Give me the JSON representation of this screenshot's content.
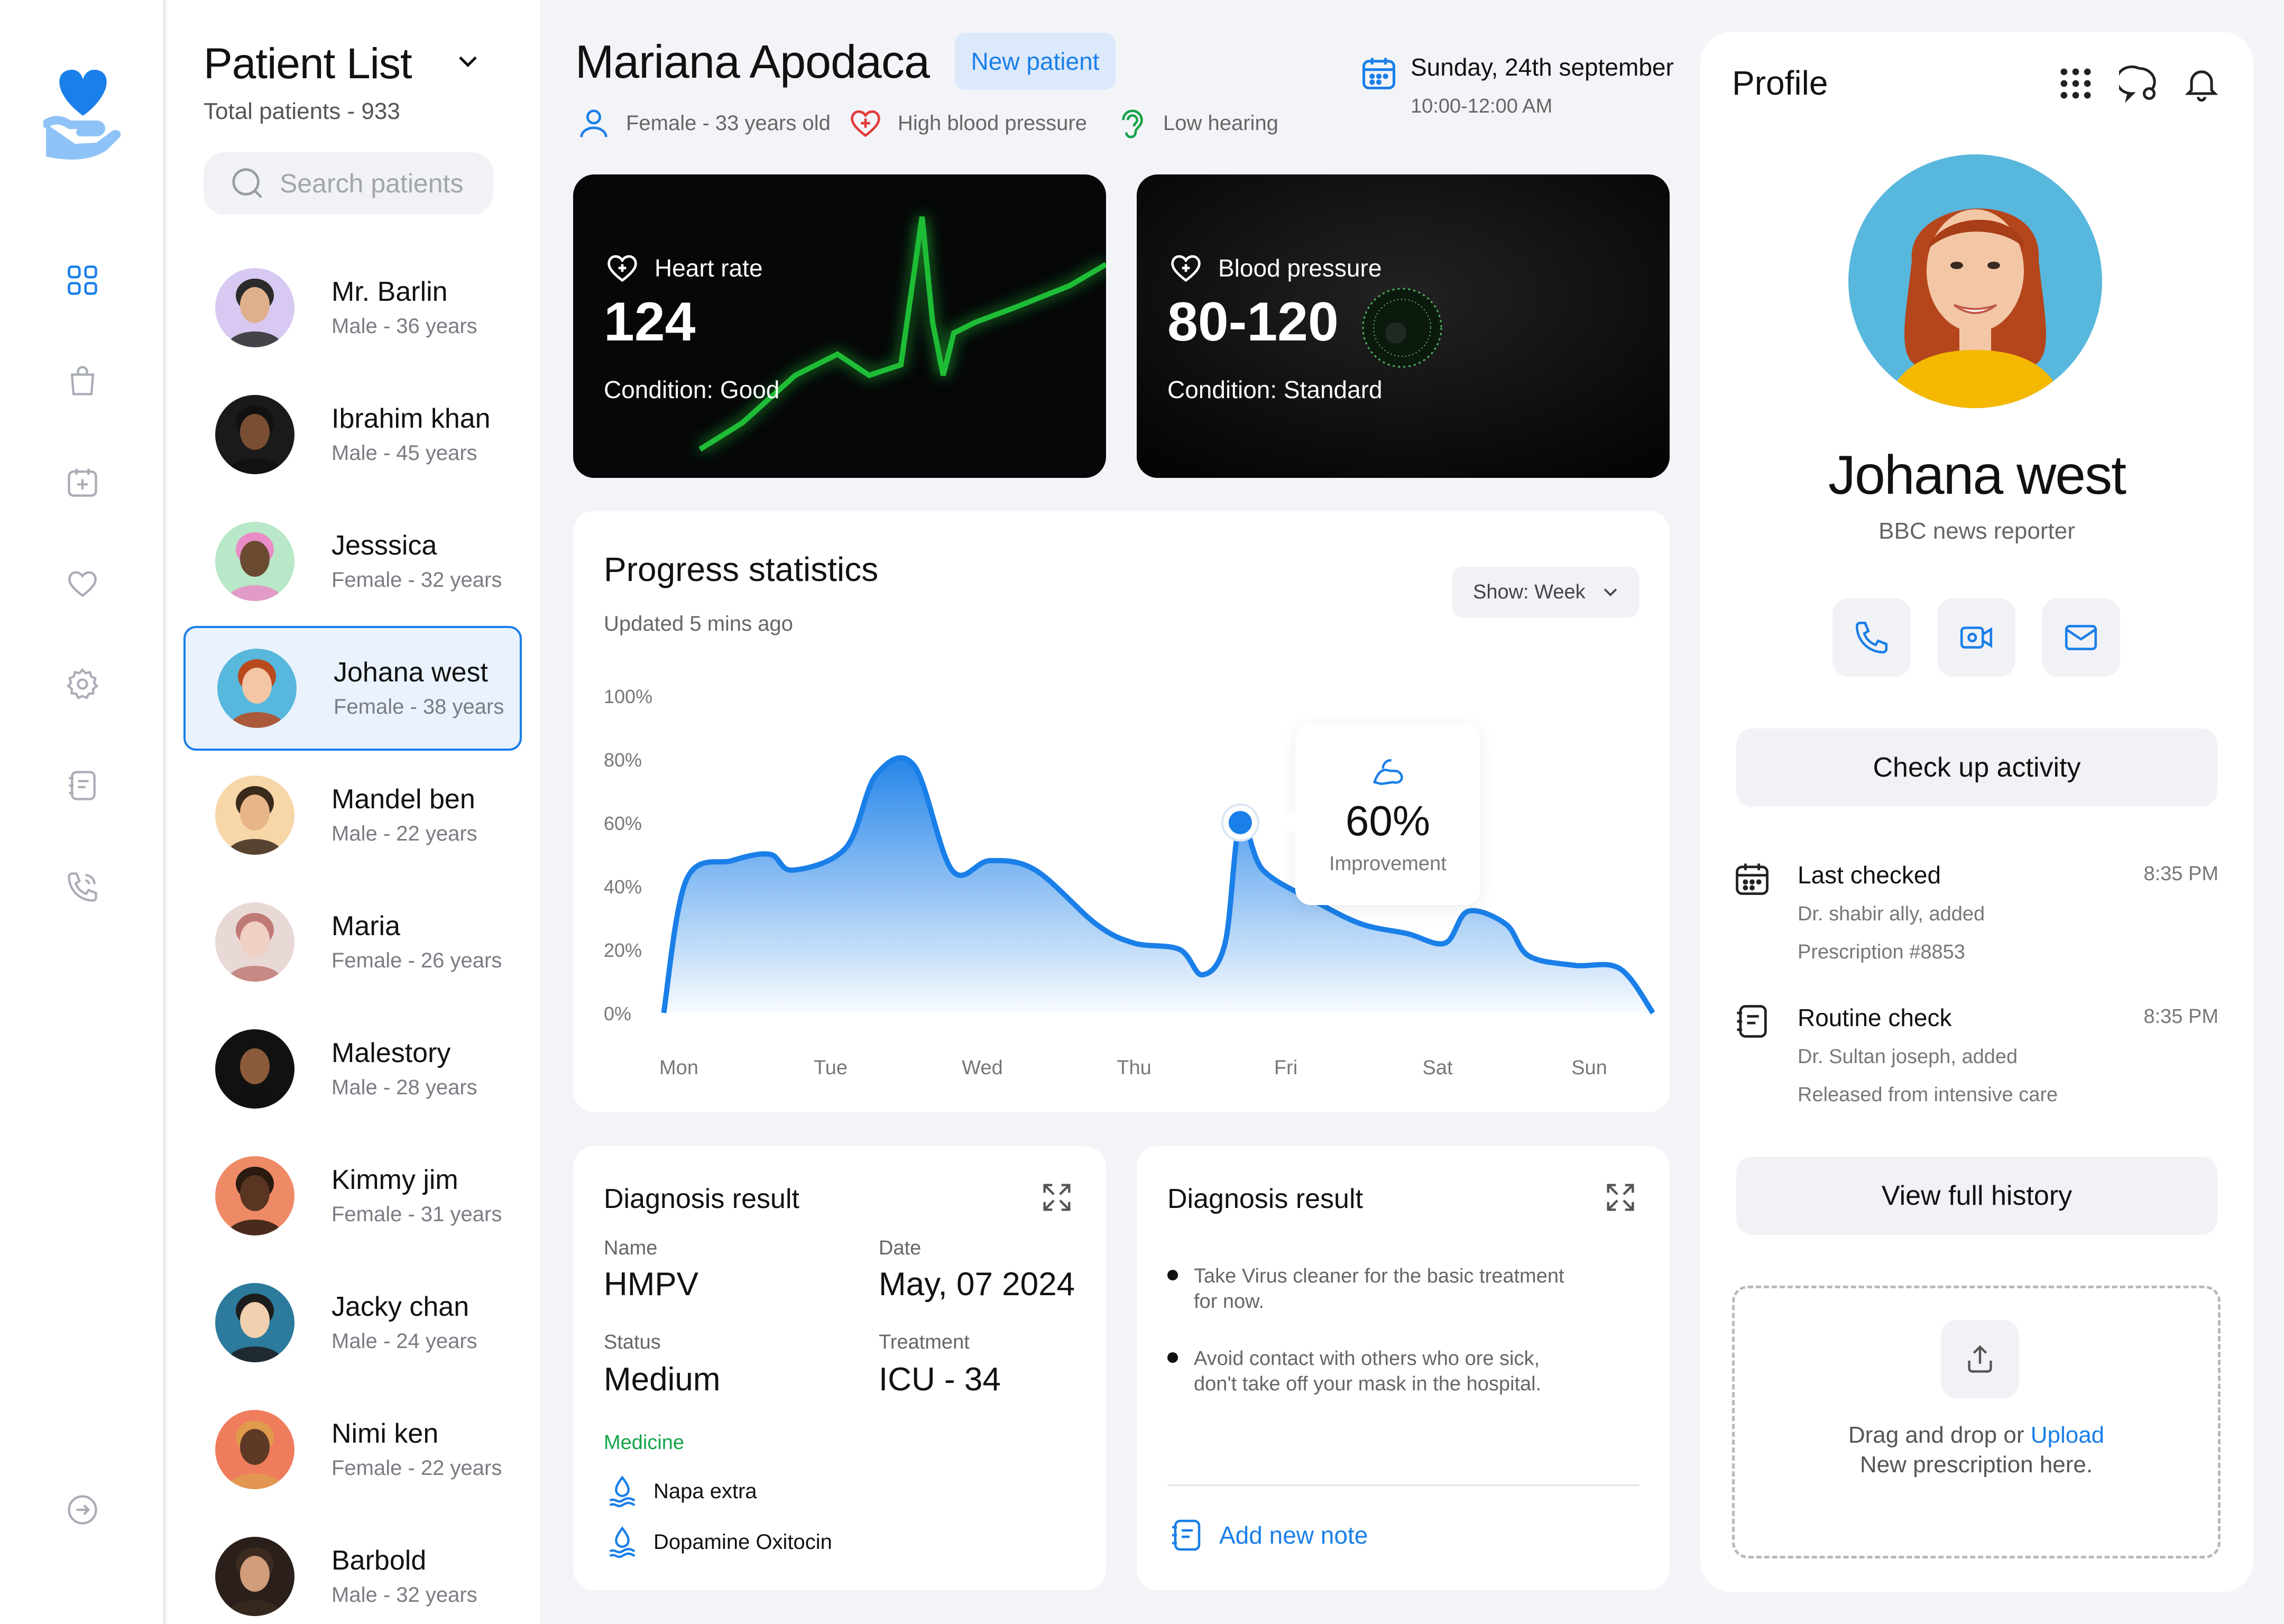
{
  "colors": {
    "accent": "#1a7fe8",
    "background": "#f3f4f8",
    "medicine_label": "#16a34a",
    "vital_glow": "#21d13a"
  },
  "rail": {
    "items": [
      {
        "name": "dashboard",
        "icon": "grid-icon",
        "active": true
      },
      {
        "name": "bag",
        "icon": "bag-icon",
        "active": false
      },
      {
        "name": "appointments",
        "icon": "calendar-plus-icon",
        "active": false
      },
      {
        "name": "favorites",
        "icon": "heart-icon",
        "active": false
      },
      {
        "name": "settings",
        "icon": "gear-icon",
        "active": false
      },
      {
        "name": "notes",
        "icon": "notes-icon",
        "active": false
      },
      {
        "name": "calls",
        "icon": "phone-icon",
        "active": false
      }
    ],
    "logout_icon": "logout-icon"
  },
  "patient_list": {
    "title": "Patient List",
    "total": "Total patients - 933",
    "search_placeholder": "Search patients",
    "patients": [
      {
        "name": "Mr. Barlin",
        "meta": "Male - 36 years",
        "active": false,
        "bg": "#d8c9f2",
        "skin": "#e0b08c",
        "hair": "#2b2b2b"
      },
      {
        "name": "Ibrahim khan",
        "meta": "Male - 45 years",
        "active": false,
        "bg": "#1a1a1a",
        "skin": "#7a4e33",
        "hair": "#111"
      },
      {
        "name": "Jesssica",
        "meta": "Female - 32 years",
        "active": false,
        "bg": "#b8e8c8",
        "skin": "#6b4a32",
        "hair": "#e98cc7"
      },
      {
        "name": "Johana west",
        "meta": "Female - 38 years",
        "active": true,
        "bg": "#58b7dc",
        "skin": "#f3c7a6",
        "hair": "#b84a1e"
      },
      {
        "name": "Mandel ben",
        "meta": "Male - 22 years",
        "active": false,
        "bg": "#f7d6a8",
        "skin": "#e7b587",
        "hair": "#3a2a1c"
      },
      {
        "name": "Maria",
        "meta": "Female - 26 years",
        "active": false,
        "bg": "#e9d9d6",
        "skin": "#f1d0c4",
        "hair": "#c07a76"
      },
      {
        "name": "Malestory",
        "meta": "Male - 28 years",
        "active": false,
        "bg": "#111",
        "skin": "#8a5a3a",
        "hair": "#111"
      },
      {
        "name": "Kimmy jim",
        "meta": "Female - 31 years",
        "active": false,
        "bg": "#ef8a67",
        "skin": "#5a3522",
        "hair": "#2a1a10"
      },
      {
        "name": "Jacky chan",
        "meta": "Male - 24 years",
        "active": false,
        "bg": "#2c7a9c",
        "skin": "#f1d0b0",
        "hair": "#1d1d1d"
      },
      {
        "name": "Nimi ken",
        "meta": "Female - 22 years",
        "active": false,
        "bg": "#ef7d5d",
        "skin": "#5e3a26",
        "hair": "#e09a4c"
      },
      {
        "name": "Barbold",
        "meta": "Male - 32 years",
        "active": false,
        "bg": "#2a1f1a",
        "skin": "#d19c7a",
        "hair": "#3a2a20"
      }
    ]
  },
  "header": {
    "patient_name": "Mariana Apodaca",
    "badge": "New patient",
    "tags": [
      {
        "icon": "user-icon",
        "label": "Female - 33 years old"
      },
      {
        "icon": "heart-plus-icon",
        "label": "High blood pressure"
      },
      {
        "icon": "ear-icon",
        "label": "Low hearing"
      }
    ],
    "date": "Sunday, 24th september",
    "time": "10:00-12:00 AM"
  },
  "vitals": [
    {
      "label": "Heart rate",
      "value": "124",
      "condition": "Condition: Good",
      "icon": "heart-plus-icon"
    },
    {
      "label": "Blood pressure",
      "value": "80-120",
      "condition": "Condition: Standard",
      "icon": "heart-plus-icon"
    }
  ],
  "progress": {
    "title": "Progress statistics",
    "updated": "Updated 5 mins ago",
    "show_label": "Show: Week",
    "tooltip_value": "60%",
    "tooltip_label": "Improvement",
    "tooltip_icon": "muscle-icon"
  },
  "chart_data": {
    "type": "area",
    "x": [
      "Mon",
      "Tue",
      "Wed",
      "Thu",
      "Fri",
      "Sat",
      "Sun"
    ],
    "y_ticks": [
      "100%",
      "80%",
      "60%",
      "40%",
      "20%",
      "0%"
    ],
    "ylim": [
      0,
      100
    ],
    "series": [
      {
        "points": [
          [
            -0.1,
            0
          ],
          [
            0.05,
            42
          ],
          [
            0.35,
            48
          ],
          [
            0.6,
            50
          ],
          [
            0.75,
            45
          ],
          [
            1.1,
            52
          ],
          [
            1.3,
            75
          ],
          [
            1.55,
            78
          ],
          [
            1.8,
            45
          ],
          [
            2.05,
            48
          ],
          [
            2.35,
            45
          ],
          [
            2.75,
            28
          ],
          [
            3.0,
            22
          ],
          [
            3.3,
            20
          ],
          [
            3.45,
            12
          ],
          [
            3.6,
            22
          ],
          [
            3.7,
            60
          ],
          [
            3.85,
            45
          ],
          [
            4.2,
            35
          ],
          [
            4.5,
            28
          ],
          [
            4.8,
            25
          ],
          [
            5.05,
            22
          ],
          [
            5.2,
            32
          ],
          [
            5.45,
            28
          ],
          [
            5.6,
            18
          ],
          [
            5.9,
            15
          ],
          [
            6.2,
            14
          ],
          [
            6.42,
            0
          ]
        ],
        "highlight": {
          "x": 3.7,
          "y": 60
        }
      }
    ]
  },
  "diagnosis_left": {
    "title": "Diagnosis result",
    "name_label": "Name",
    "name_value": "HMPV",
    "date_label": "Date",
    "date_value": "May, 07 2024",
    "status_label": "Status",
    "status_value": "Medium",
    "treatment_label": "Treatment",
    "treatment_value": "ICU - 34",
    "medicine_label": "Medicine",
    "medicines": [
      "Napa extra",
      "Dopamine Oxitocin"
    ]
  },
  "diagnosis_right": {
    "title": "Diagnosis result",
    "bullets": [
      "Take Virus cleaner for the basic treatment for now.",
      "Avoid contact with others who ore sick, don't take off your mask in the hospital."
    ],
    "add_note": "Add new note"
  },
  "profile": {
    "title": "Profile",
    "name": "Johana west",
    "role": "BBC news reporter",
    "check_up": "Check up activity",
    "activities": [
      {
        "title": "Last checked",
        "time": "8:35 PM",
        "line1": "Dr. shabir ally, added",
        "line2": "Prescription #8853",
        "icon": "calendar-icon"
      },
      {
        "title": "Routine check",
        "time": "8:35 PM",
        "line1": "Dr. Sultan joseph, added",
        "line2": "Released from intensive care",
        "icon": "notes-icon"
      }
    ],
    "view_history": "View full history",
    "upload_prefix": "Drag and drop or",
    "upload_link": "Upload",
    "upload_suffix": "New prescription here."
  }
}
